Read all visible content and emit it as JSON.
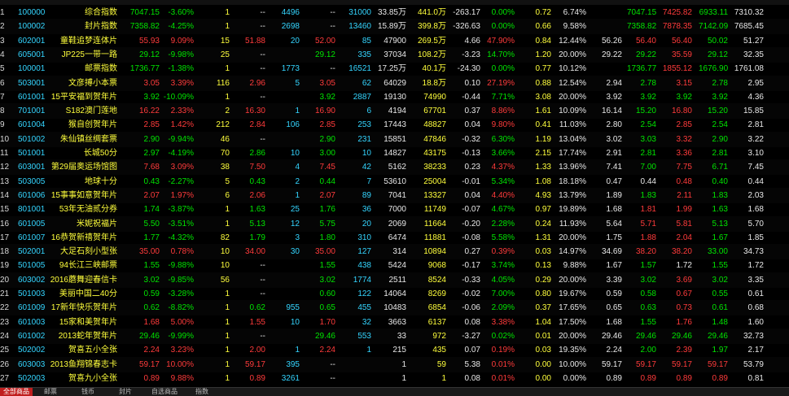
{
  "columns": [
    "idx",
    "code",
    "name",
    "price",
    "pct",
    "qty",
    "bid",
    "bidvol",
    "ask",
    "askvol",
    "vol",
    "turn",
    "amt",
    "chg",
    "chgpct",
    "ratio",
    "rate",
    "prev",
    "open",
    "high",
    "low",
    "avg"
  ],
  "rows": [
    [
      "1",
      "100000",
      "综合指数",
      "7047.15",
      "-3.60%",
      "1",
      "--",
      "4496",
      "--",
      "31000",
      "33.85万",
      "441.0万",
      "-263.17",
      "0.00%",
      "0.72",
      "6.74%",
      "",
      "7047.15",
      "7425.82",
      "6933.11",
      "7310.32"
    ],
    [
      "2",
      "100002",
      "封片指数",
      "7358.82",
      "-4.25%",
      "1",
      "--",
      "2698",
      "--",
      "13460",
      "15.89万",
      "399.8万",
      "-326.63",
      "0.00%",
      "0.66",
      "9.58%",
      "",
      "7358.82",
      "7878.35",
      "7142.09",
      "7685.45"
    ],
    [
      "3",
      "602001",
      "童鞋追梦连体片",
      "55.93",
      "9.09%",
      "15",
      "51.88",
      "20",
      "52.00",
      "85",
      "47900",
      "269.5万",
      "4.66",
      "47.90%",
      "0.84",
      "12.44%",
      "56.26",
      "56.40",
      "56.40",
      "50.02",
      "51.27"
    ],
    [
      "4",
      "605001",
      "JP225一带一路",
      "29.12",
      "-9.98%",
      "25",
      "--",
      "",
      "29.12",
      "335",
      "37034",
      "108.2万",
      "-3.23",
      "14.70%",
      "1.20",
      "20.00%",
      "29.22",
      "29.22",
      "35.59",
      "29.12",
      "32.35"
    ],
    [
      "5",
      "100001",
      "邮票指数",
      "1736.77",
      "-1.38%",
      "1",
      "--",
      "1773",
      "--",
      "16521",
      "17.25万",
      "40.1万",
      "-24.30",
      "0.00%",
      "0.77",
      "10.12%",
      "",
      "1736.77",
      "1855.12",
      "1676.90",
      "1761.08"
    ],
    [
      "6",
      "503001",
      "文彦搏小本票",
      "3.05",
      "3.39%",
      "116",
      "2.96",
      "5",
      "3.05",
      "62",
      "64029",
      "18.8万",
      "0.10",
      "27.19%",
      "0.88",
      "12.54%",
      "2.94",
      "2.78",
      "3.15",
      "2.78",
      "2.95"
    ],
    [
      "7",
      "601001",
      "15平安福到贺年片",
      "3.92",
      "-10.09%",
      "1",
      "--",
      "",
      "3.92",
      "2887",
      "19130",
      "74990",
      "-0.44",
      "7.71%",
      "3.08",
      "20.00%",
      "3.92",
      "3.92",
      "3.92",
      "3.92",
      "4.36"
    ],
    [
      "8",
      "701001",
      "S182澳门莲地",
      "16.22",
      "2.33%",
      "2",
      "16.30",
      "1",
      "16.90",
      "6",
      "4194",
      "67701",
      "0.37",
      "8.86%",
      "1.61",
      "10.09%",
      "16.14",
      "15.20",
      "16.80",
      "15.20",
      "15.85"
    ],
    [
      "9",
      "601004",
      "猴自创贺年片",
      "2.85",
      "1.42%",
      "212",
      "2.84",
      "106",
      "2.85",
      "253",
      "17443",
      "48827",
      "0.04",
      "9.80%",
      "0.41",
      "11.03%",
      "2.80",
      "2.54",
      "2.85",
      "2.54",
      "2.81"
    ],
    [
      "10",
      "501002",
      "朱仙镇丝绸套票",
      "2.90",
      "-9.94%",
      "46",
      "--",
      "",
      "2.90",
      "231",
      "15851",
      "47846",
      "-0.32",
      "6.30%",
      "1.19",
      "13.04%",
      "3.02",
      "3.03",
      "3.32",
      "2.90",
      "3.22"
    ],
    [
      "11",
      "501001",
      "长城50分",
      "2.97",
      "-4.19%",
      "70",
      "2.86",
      "10",
      "3.00",
      "10",
      "14827",
      "43175",
      "-0.13",
      "3.66%",
      "2.15",
      "17.74%",
      "2.91",
      "2.81",
      "3.36",
      "2.81",
      "3.10"
    ],
    [
      "12",
      "603001",
      "第29届奥运场馆图",
      "7.68",
      "3.09%",
      "38",
      "7.50",
      "4",
      "7.45",
      "42",
      "5162",
      "38233",
      "0.23",
      "4.37%",
      "1.33",
      "13.96%",
      "7.41",
      "7.00",
      "7.75",
      "6.71",
      "7.45"
    ],
    [
      "13",
      "503005",
      "地球十分",
      "0.43",
      "-2.27%",
      "5",
      "0.43",
      "2",
      "0.44",
      "7",
      "53610",
      "25004",
      "-0.01",
      "5.34%",
      "1.08",
      "18.18%",
      "0.47",
      "0.44",
      "0.48",
      "0.40",
      "0.44"
    ],
    [
      "14",
      "601006",
      "15事事如意贺年片",
      "2.07",
      "1.97%",
      "6",
      "2.06",
      "1",
      "2.07",
      "89",
      "7041",
      "13327",
      "0.04",
      "4.40%",
      "4.93",
      "13.79%",
      "1.89",
      "1.83",
      "2.11",
      "1.83",
      "2.03"
    ],
    [
      "15",
      "801001",
      "53年无油贰分券",
      "1.74",
      "-3.87%",
      "1",
      "1.63",
      "25",
      "1.76",
      "36",
      "7000",
      "11749",
      "-0.07",
      "4.67%",
      "0.97",
      "19.89%",
      "1.68",
      "1.81",
      "1.99",
      "1.63",
      "1.68"
    ],
    [
      "16",
      "601005",
      "米妮祝福片",
      "5.50",
      "-3.51%",
      "1",
      "5.13",
      "12",
      "5.75",
      "20",
      "2069",
      "11664",
      "-0.20",
      "2.28%",
      "0.24",
      "11.93%",
      "5.64",
      "5.71",
      "5.81",
      "5.13",
      "5.70"
    ],
    [
      "17",
      "601007",
      "16恭贺新禧贺年片",
      "1.77",
      "-4.32%",
      "82",
      "1.79",
      "3",
      "1.80",
      "310",
      "6474",
      "11881",
      "-0.08",
      "5.58%",
      "1.31",
      "20.00%",
      "1.75",
      "1.88",
      "2.04",
      "1.67",
      "1.85"
    ],
    [
      "18",
      "502001",
      "大足石刻小型张",
      "35.00",
      "0.78%",
      "10",
      "34.00",
      "30",
      "35.00",
      "127",
      "314",
      "10894",
      "0.27",
      "0.39%",
      "0.03",
      "14.97%",
      "34.69",
      "38.20",
      "38.20",
      "33.00",
      "34.73"
    ],
    [
      "19",
      "501005",
      "94长江三峡邮票",
      "1.55",
      "-9.88%",
      "10",
      "--",
      "",
      "1.55",
      "438",
      "5424",
      "9068",
      "-0.17",
      "3.74%",
      "0.13",
      "9.88%",
      "1.67",
      "1.57",
      "1.72",
      "1.55",
      "1.72"
    ],
    [
      "20",
      "603002",
      "2016蘑舞迎春信卡",
      "3.02",
      "-9.85%",
      "56",
      "--",
      "",
      "3.02",
      "1774",
      "2511",
      "8524",
      "-0.33",
      "4.05%",
      "0.29",
      "20.00%",
      "3.39",
      "3.02",
      "3.69",
      "3.02",
      "3.35"
    ],
    [
      "21",
      "501003",
      "美丽中国二40分",
      "0.59",
      "-3.28%",
      "1",
      "--",
      "",
      "0.60",
      "122",
      "14064",
      "8269",
      "-0.02",
      "7.00%",
      "0.80",
      "19.67%",
      "0.59",
      "0.58",
      "0.67",
      "0.55",
      "0.61"
    ],
    [
      "22",
      "601009",
      "17新年快乐贺年片",
      "0.62",
      "-8.82%",
      "1",
      "0.62",
      "955",
      "0.65",
      "455",
      "10483",
      "6854",
      "-0.06",
      "2.09%",
      "0.37",
      "17.65%",
      "0.65",
      "0.63",
      "0.73",
      "0.61",
      "0.68"
    ],
    [
      "23",
      "601003",
      "15家和美贺年片",
      "1.68",
      "5.00%",
      "1",
      "1.55",
      "10",
      "1.70",
      "32",
      "3663",
      "6137",
      "0.08",
      "3.38%",
      "1.04",
      "17.50%",
      "1.68",
      "1.55",
      "1.76",
      "1.48",
      "1.60"
    ],
    [
      "24",
      "601002",
      "2013蛇年贺年片",
      "29.46",
      "-9.99%",
      "1",
      "--",
      "",
      "29.46",
      "553",
      "33",
      "972",
      "-3.27",
      "0.02%",
      "0.01",
      "20.00%",
      "29.46",
      "29.46",
      "29.46",
      "29.46",
      "32.73"
    ],
    [
      "25",
      "502002",
      "贺喜五小全张",
      "2.24",
      "3.23%",
      "1",
      "2.00",
      "1",
      "2.24",
      "1",
      "215",
      "435",
      "0.07",
      "0.19%",
      "0.03",
      "19.35%",
      "2.24",
      "2.00",
      "2.39",
      "1.97",
      "2.17"
    ],
    [
      "26",
      "603003",
      "2013鱼翔锦春志卡",
      "59.17",
      "10.00%",
      "1",
      "59.17",
      "395",
      "--",
      "",
      "1",
      "59",
      "5.38",
      "0.01%",
      "0.00",
      "10.00%",
      "59.17",
      "59.17",
      "59.17",
      "59.17",
      "53.79"
    ],
    [
      "27",
      "502003",
      "贺喜九小全张",
      "0.89",
      "9.88%",
      "1",
      "0.89",
      "3261",
      "--",
      "",
      "1",
      "1",
      "0.08",
      "0.01%",
      "0.00",
      "0.00%",
      "0.89",
      "0.89",
      "0.89",
      "0.89",
      "0.81"
    ]
  ],
  "tabs": [
    "全部商品",
    "邮票",
    "钱币",
    "封片",
    "自选商品",
    "指数"
  ],
  "colors": {
    "up": "#ff3b3b",
    "down": "#00e400",
    "flat": "#e8e8e8",
    "name": "#ffff3c",
    "code": "#34d5ff"
  }
}
